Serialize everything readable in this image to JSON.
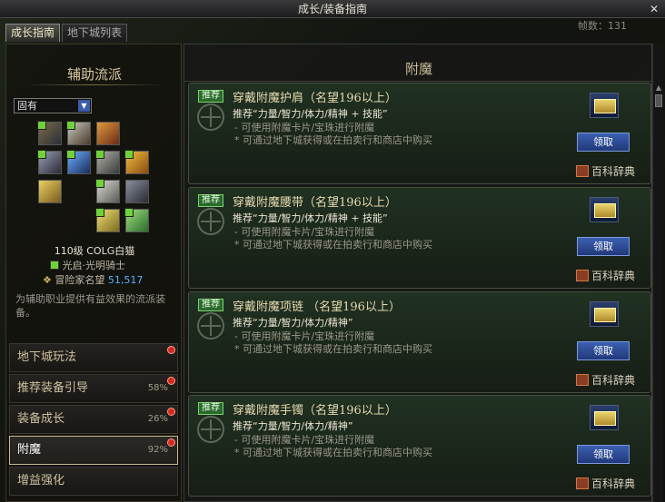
{
  "window": {
    "title": "成长/装备指南",
    "close": "✕"
  },
  "tabs": [
    {
      "label": "成长指南"
    },
    {
      "label": "地下城列表"
    }
  ],
  "fps": "帧数：131",
  "left": {
    "title": "辅助流派",
    "select": {
      "value": "固有"
    },
    "character": {
      "level_name": "110级 COLG白猫",
      "job": "光启·光明骑士",
      "fame_label": "冒险家名望",
      "fame_value": "51,517"
    },
    "description": "为辅助职业提供有益效果的流派装备。",
    "nav": [
      {
        "label": "地下城玩法",
        "pct": "",
        "alert": true
      },
      {
        "label": "推荐装备引导",
        "pct": "58%",
        "alert": true
      },
      {
        "label": "装备成长",
        "pct": "26%",
        "alert": true
      },
      {
        "label": "附魔",
        "pct": "92%",
        "alert": true
      },
      {
        "label": "增益强化",
        "pct": "",
        "alert": false
      }
    ]
  },
  "right": {
    "title": "附魔",
    "cards": [
      {
        "badge": "推荐",
        "title": "穿戴附魔护肩（名望196以上）",
        "line1": "推荐“力量/智力/体力/精神 + 技能”",
        "line2": "- 可使用附魔卡片/宝珠进行附魔",
        "line3": "* 可通过地下城获得或在拍卖行和商店中购买",
        "button": "领取",
        "wiki": "百科辞典"
      },
      {
        "badge": "推荐",
        "title": "穿戴附魔腰带（名望196以上）",
        "line1": "推荐“力量/智力/体力/精神 + 技能”",
        "line2": "- 可使用附魔卡片/宝珠进行附魔",
        "line3": "* 可通过地下城获得或在拍卖行和商店中购买",
        "button": "领取",
        "wiki": "百科辞典"
      },
      {
        "badge": "推荐",
        "title": "穿戴附魔项链 （名望196以上）",
        "line1": "推荐“力量/智力/体力/精神”",
        "line2": "- 可使用附魔卡片/宝珠进行附魔",
        "line3": "* 可通过地下城获得或在拍卖行和商店中购买",
        "button": "领取",
        "wiki": "百科辞典"
      },
      {
        "badge": "推荐",
        "title": "穿戴附魔手镯（名望196以上）",
        "line1": "推荐“力量/智力/体力/精神”",
        "line2": "- 可使用附魔卡片/宝珠进行附魔",
        "line3": "* 可通过地下城获得或在拍卖行和商店中购买",
        "button": "领取",
        "wiki": "百科辞典"
      }
    ]
  }
}
